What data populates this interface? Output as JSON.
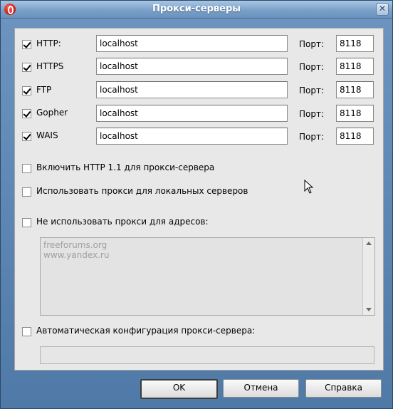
{
  "window": {
    "title": "Прокси-серверы",
    "close_glyph": "✕",
    "app_icon": "opera-logo-icon"
  },
  "proxies": [
    {
      "enabled": true,
      "protocol": "HTTP:",
      "host": "localhost",
      "port_label": "Порт:",
      "port": "8118"
    },
    {
      "enabled": true,
      "protocol": "HTTPS",
      "host": "localhost",
      "port_label": "Порт:",
      "port": "8118"
    },
    {
      "enabled": true,
      "protocol": "FTP",
      "host": "localhost",
      "port_label": "Порт:",
      "port": "8118"
    },
    {
      "enabled": true,
      "protocol": "Gopher",
      "host": "localhost",
      "port_label": "Порт:",
      "port": "8118"
    },
    {
      "enabled": true,
      "protocol": "WAIS",
      "host": "localhost",
      "port_label": "Порт:",
      "port": "8118"
    }
  ],
  "options": {
    "http11": {
      "checked": false,
      "label": "Включить HTTP 1.1 для прокси-сервера"
    },
    "local": {
      "checked": false,
      "label": "Использовать прокси для локальных серверов"
    },
    "exclude": {
      "checked": false,
      "label": "Не использовать прокси для адресов:",
      "lines": [
        "freeforums.org",
        "www.yandex.ru"
      ]
    },
    "autoconfig": {
      "checked": false,
      "label": "Автоматическая конфигурация прокси-сервера:",
      "url": ""
    }
  },
  "buttons": {
    "ok": "OK",
    "cancel": "Отмена",
    "help": "Справка"
  },
  "colors": {
    "title_bar": "#7aa0c8",
    "panel": "#e8e8e8",
    "disabled_text": "#a0a0a0"
  }
}
